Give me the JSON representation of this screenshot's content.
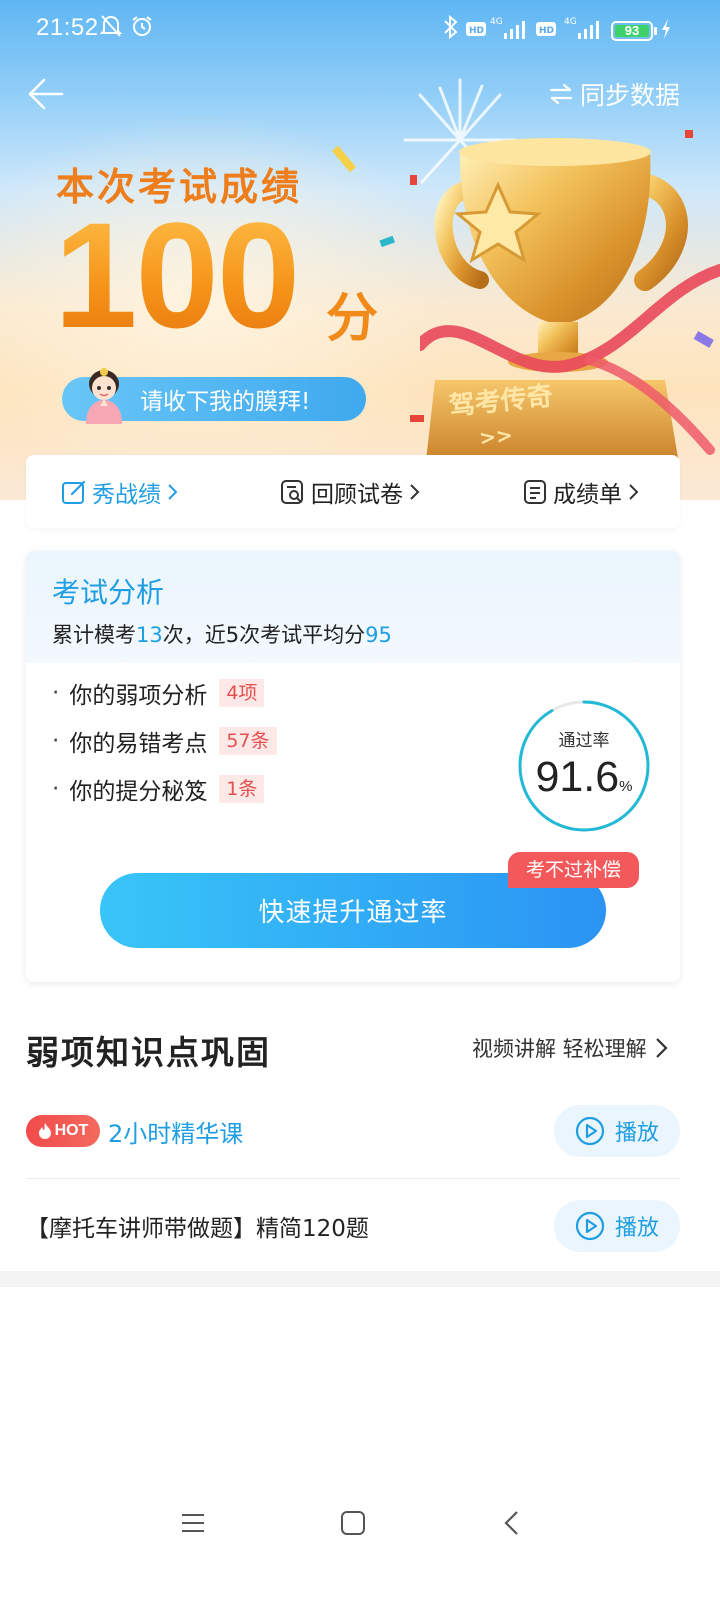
{
  "status_bar": {
    "time": "21:52",
    "battery": "93"
  },
  "header": {
    "sync_label": "同步数据"
  },
  "hero": {
    "title": "本次考试成绩",
    "score": "100",
    "unit": "分",
    "worship_text": "请收下我的膜拜!",
    "trophy_text": "驾考传奇"
  },
  "actions": [
    {
      "label": "秀战绩"
    },
    {
      "label": "回顾试卷"
    },
    {
      "label": "成绩单"
    }
  ],
  "analysis": {
    "title": "考试分析",
    "summary_prefix": "累计模考",
    "mock_count": "13",
    "summary_mid": "次，近5次考试平均分",
    "avg_score": "95",
    "items": [
      {
        "label": "你的弱项分析",
        "tag": "4项"
      },
      {
        "label": "你的易错考点",
        "tag": "57条"
      },
      {
        "label": "你的提分秘笈",
        "tag": "1条"
      }
    ],
    "pass_rate_label": "通过率",
    "pass_rate_value": "91.6",
    "pass_rate_unit": "%",
    "boost_button": "快速提升通过率",
    "compensate_badge": "考不过补偿"
  },
  "weak_section": {
    "title": "弱项知识点巩固",
    "link": "视频讲解 轻松理解",
    "courses": [
      {
        "badge": "HOT",
        "title": "2小时精华课",
        "play": "播放"
      },
      {
        "title": "【摩托车讲师带做题】精简120题",
        "play": "播放"
      }
    ]
  },
  "colors": {
    "accent_blue": "#1f9ee3",
    "score_orange": "#f39a22",
    "tag_red": "#e5504f"
  }
}
